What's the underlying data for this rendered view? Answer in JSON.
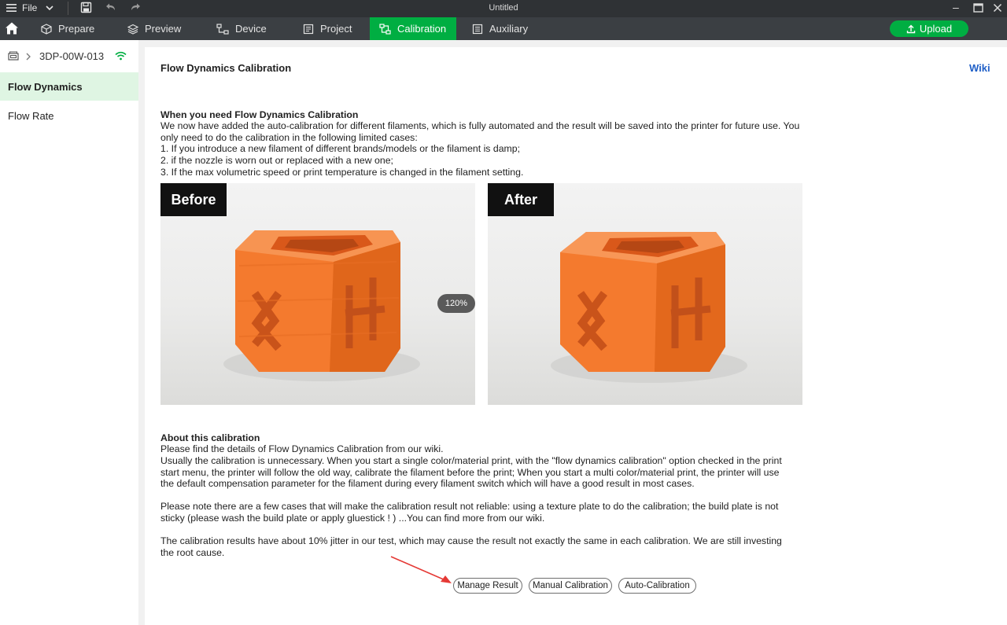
{
  "titlebar": {
    "file_label": "File",
    "window_title": "Untitled"
  },
  "nav": {
    "tabs": [
      {
        "label": "Prepare",
        "icon": "cube-icon"
      },
      {
        "label": "Preview",
        "icon": "layers-icon"
      },
      {
        "label": "Device",
        "icon": "device-icon"
      },
      {
        "label": "Project",
        "icon": "project-icon"
      },
      {
        "label": "Calibration",
        "icon": "calibration-icon",
        "active": true
      },
      {
        "label": "Auxiliary",
        "icon": "auxiliary-icon"
      }
    ],
    "upload_label": "Upload"
  },
  "sidebar": {
    "device_name": "3DP-00W-013",
    "items": [
      {
        "label": "Flow Dynamics",
        "active": true
      },
      {
        "label": "Flow Rate",
        "active": false
      }
    ]
  },
  "main": {
    "title": "Flow Dynamics Calibration",
    "wiki_label": "Wiki",
    "when_heading": "When you need Flow Dynamics Calibration",
    "when_body": "We now have added the auto-calibration for different filaments, which is fully automated and the result will be saved into the printer for future use. You only need to do the calibration in the following limited cases:\n1. If you introduce a new filament of different brands/models or the filament is damp;\n2. if the nozzle is worn out or replaced with a new one;\n3. If the max volumetric speed or print temperature is changed in the filament setting.",
    "before_label": "Before",
    "after_label": "After",
    "zoom_label": "120%",
    "about_heading": "About this calibration",
    "about_body": "Please find the details of Flow Dynamics Calibration from our wiki.",
    "para_usually": "Usually the calibration is unnecessary. When you start a single color/material print, with the \"flow dynamics calibration\" option checked in the print start menu, the printer will follow the old way, calibrate the filament before the print; When you start a multi color/material print, the printer will use the default compensation parameter for the filament during every filament switch which will have a good result in most cases.",
    "para_note": "Please note there are a few cases that will make the calibration result not reliable: using a texture plate to do the calibration; the build plate is not sticky (please wash the build plate or apply gluestick ! ) ...You can find more from our wiki.",
    "para_jitter": "The calibration results have about 10% jitter in our test, which may cause the result not exactly the same in each calibration. We are still investing the root cause.",
    "buttons": {
      "manage": "Manage Result",
      "manual": "Manual Calibration",
      "auto": "Auto-Calibration"
    }
  },
  "colors": {
    "accent": "#00ae42",
    "nav_bg": "#3b3f43",
    "titlebar_bg": "#2f3235",
    "sidebar_active_bg": "#dff5e3",
    "wiki_link": "#1f5fc7",
    "annotation_arrow": "#e53935",
    "print_orange": "#f47a2e"
  }
}
